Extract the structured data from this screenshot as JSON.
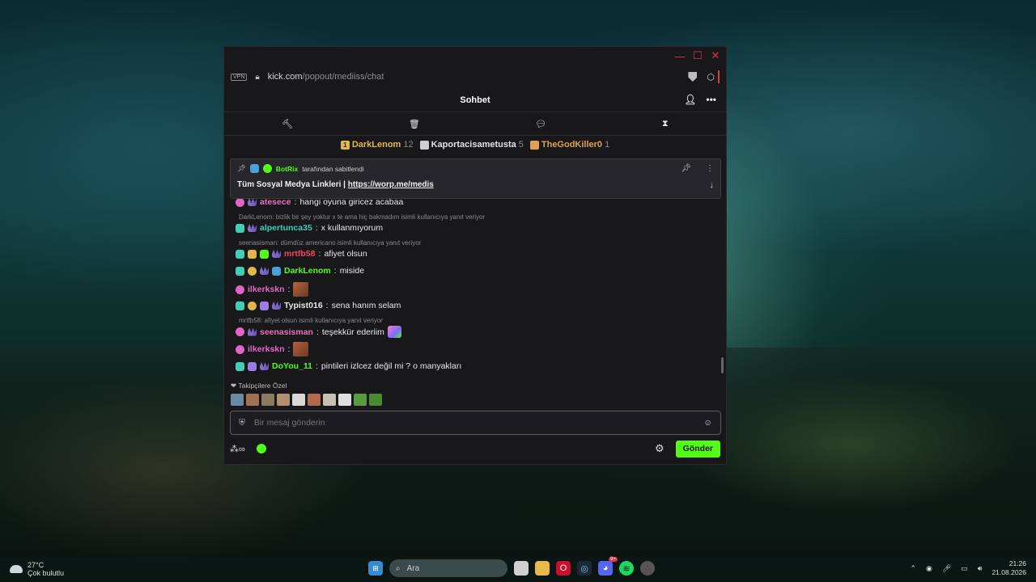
{
  "window": {
    "controls": {
      "minimize": "—",
      "maximize": "☐",
      "close": "✕"
    }
  },
  "address_bar": {
    "vpn_label": "VPN",
    "url_host": "kick.com",
    "url_path": "/popout/mediiss/chat"
  },
  "chat": {
    "title": "Sohbet",
    "mod_tools": [
      "moderation-hammer",
      "trash",
      "chat-bubble",
      "hourglass"
    ],
    "top_gifters": [
      {
        "name": "DarkLenom",
        "count": "12",
        "tier": "gold"
      },
      {
        "name": "Kaportacisametusta",
        "count": "5",
        "tier": "silver"
      },
      {
        "name": "TheGodKiller0",
        "count": "1",
        "tier": "orange"
      }
    ],
    "pinned": {
      "author": "BotRix",
      "pinned_by_text": "tarafından sabitlendi",
      "text_prefix": "Tüm Sosyal Medya Linkleri | ",
      "link": "https://worp.me/medis"
    },
    "messages": [
      {
        "user": "atesece",
        "text": "hangi oyuna giricez acabaa",
        "color": "#ea6fbf"
      },
      {
        "reply": "DarkLenom: bizlik bir şey yoktur x te ama hiç bakmadım isimli kullanıcıya yanıt veriyor"
      },
      {
        "user": "alpertunca35",
        "text": "x kullanmıyorum",
        "color": "#3ecfb6"
      },
      {
        "reply": "seenasisman: dümdüz americano isimli kullanıcıya yanıt veriyor"
      },
      {
        "user": "mrtfb58",
        "text": "afiyet olsun",
        "color": "#f4475d"
      },
      {
        "user": "DarkLenom",
        "text": "miside",
        "color": "#53fc18"
      },
      {
        "user": "ilkerkskn",
        "text": "",
        "color": "#e463c8"
      },
      {
        "user": "Typist016",
        "text": "sena hanım selam",
        "color": "#e6e6e6"
      },
      {
        "reply": "mrtfb58: afiyet olsun isimli kullanıcıya yanıt veriyor"
      },
      {
        "user": "seenasisman",
        "text": "teşekkür ederiim",
        "color": "#ea6fbf"
      },
      {
        "user": "ilkerkskn",
        "text": "",
        "color": "#e463c8"
      },
      {
        "user": "DoYou_11",
        "text": "pintileri izlcez değil mi ? o manyakları",
        "color": "#53fc18"
      }
    ],
    "favorites_label": "Takipçilere Özel",
    "input_placeholder": "Bir mesaj gönderin",
    "send_label": "Gönder"
  },
  "taskbar": {
    "weather_temp": "27°C",
    "weather_desc": "Çok bulutlu",
    "search_placeholder": "Ara",
    "time": "21:26",
    "date": "21.08.2026",
    "discord_badge": "9+"
  },
  "colors": {
    "accent": "#53fc18",
    "close_red": "#e0334d",
    "bg": "#18181b"
  }
}
